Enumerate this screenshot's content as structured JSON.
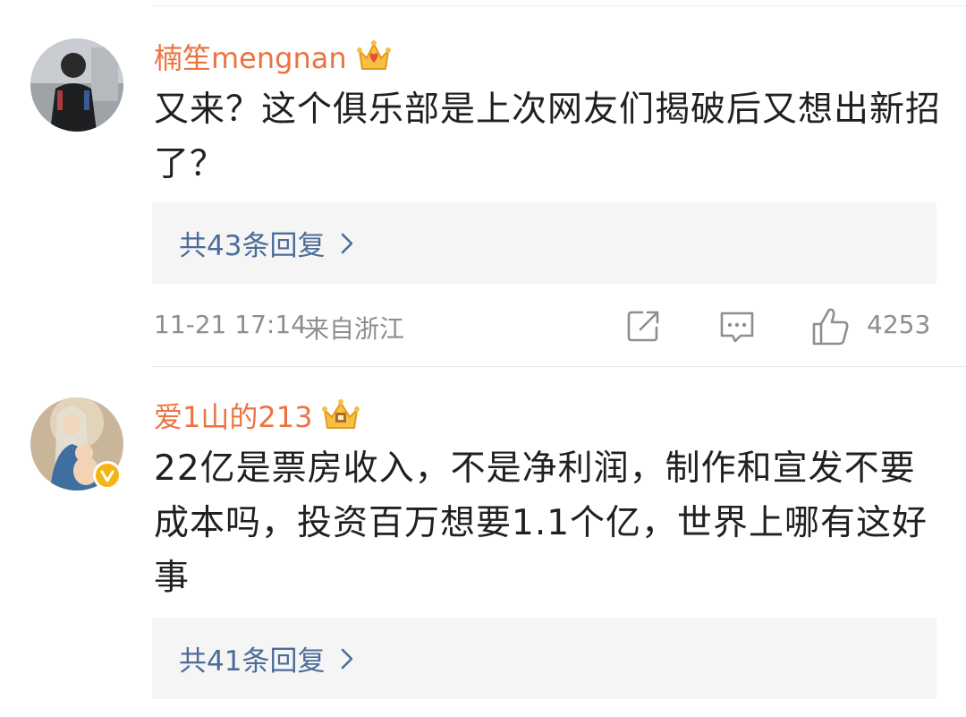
{
  "comments": [
    {
      "username": "楠笙mengnan",
      "text": "又来？这个俱乐部是上次网友们揭破后又想出新招了？",
      "replies_label": "共43条回复",
      "time": "11-21 17:14",
      "location": "来自浙江",
      "likes": "4253",
      "verified": false
    },
    {
      "username": "爱1山的213",
      "text": "22亿是票房收入，不是净利润，制作和宣发不要成本吗，投资百万想要1.1个亿，世界上哪有这好事",
      "replies_label": "共41条回复",
      "verified": true
    }
  ],
  "colors": {
    "username": "#eb7340",
    "reply_link": "#4b6d9a",
    "meta": "#8e8e8e",
    "body_text": "#202020",
    "reply_box_bg": "#f5f5f5",
    "verified_badge": "#f3b415"
  },
  "icons": [
    "crown-icon",
    "chevron-right-icon",
    "share-icon",
    "comment-icon",
    "like-icon",
    "verified-icon"
  ]
}
